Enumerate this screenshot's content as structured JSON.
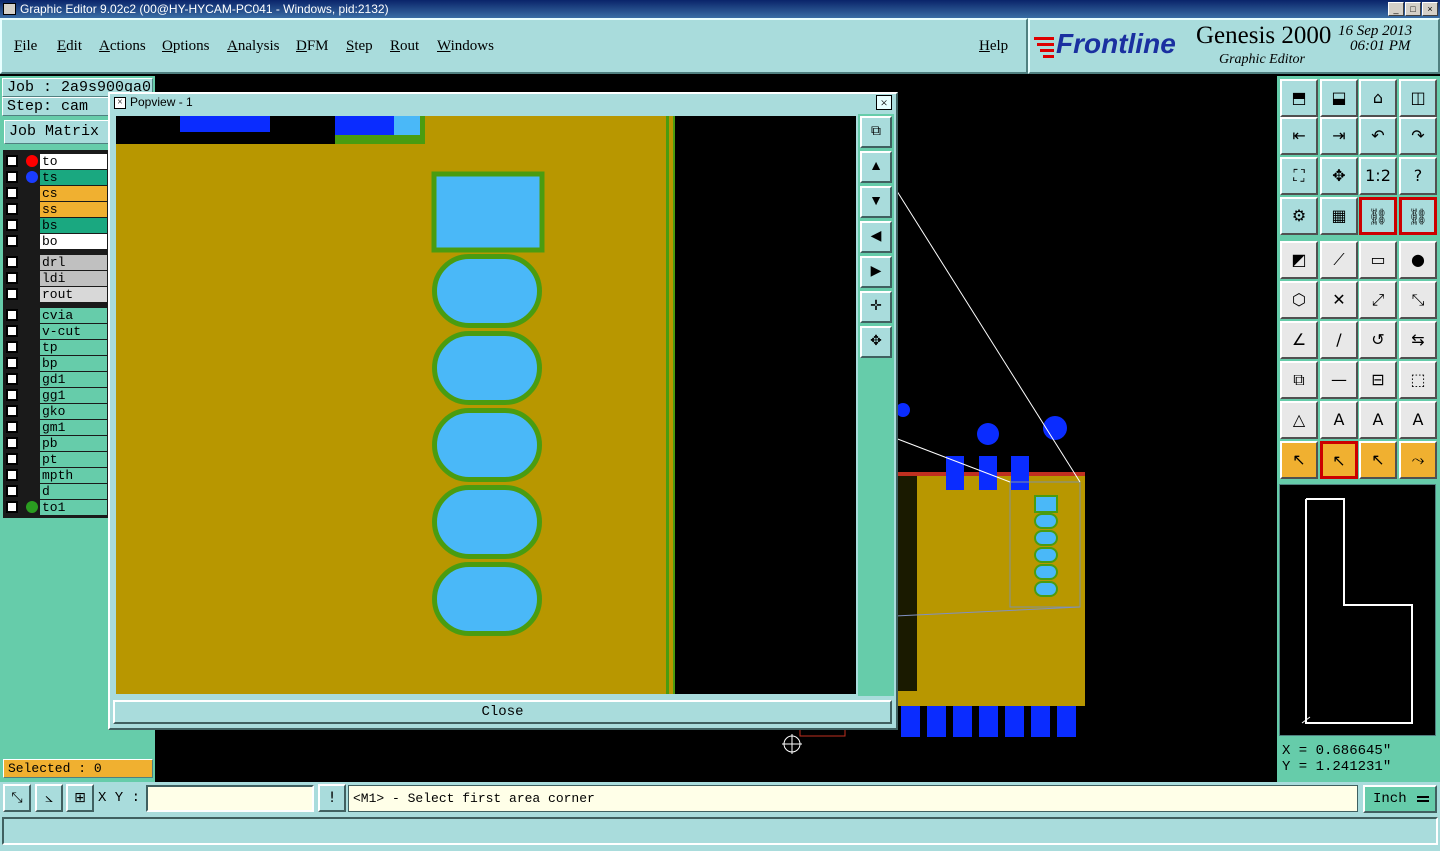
{
  "window": {
    "title": "Graphic Editor 9.02c2 (00@HY-HYCAM-PC041 - Windows, pid:2132)"
  },
  "menu": {
    "items": [
      "File",
      "Edit",
      "Actions",
      "Options",
      "Analysis",
      "DFM",
      "Step",
      "Rout",
      "Windows"
    ],
    "help": "Help"
  },
  "brand": {
    "logo": "Frontline",
    "product": "Genesis 2000",
    "subtitle": "Graphic Editor",
    "date": "16 Sep 2013",
    "time": "06:01 PM"
  },
  "job": {
    "job_label": "Job : 2a9s900ga0",
    "step_label": "Step: cam",
    "matrix_button": "Job Matrix"
  },
  "layers": [
    {
      "name": "to",
      "bg": "#ffffff",
      "dot": "#ff0000"
    },
    {
      "name": "ts",
      "bg": "#1aa880",
      "dot": "#1a3cff"
    },
    {
      "name": "cs",
      "bg": "#f0b030",
      "dot": ""
    },
    {
      "name": "ss",
      "bg": "#f0b030",
      "dot": ""
    },
    {
      "name": "bs",
      "bg": "#1aa880",
      "dot": ""
    },
    {
      "name": "bo",
      "bg": "#ffffff",
      "dot": ""
    },
    {
      "name": "drl",
      "bg": "#c0c0c0",
      "dot": ""
    },
    {
      "name": "ldi",
      "bg": "#c0c0c0",
      "dot": ""
    },
    {
      "name": "rout",
      "bg": "#d8d8d8",
      "dot": ""
    },
    {
      "name": "cvia",
      "bg": "#66ccaa",
      "dot": ""
    },
    {
      "name": "v-cut",
      "bg": "#66ccaa",
      "dot": ""
    },
    {
      "name": "tp",
      "bg": "#66ccaa",
      "dot": ""
    },
    {
      "name": "bp",
      "bg": "#66ccaa",
      "dot": ""
    },
    {
      "name": "gd1",
      "bg": "#66ccaa",
      "dot": ""
    },
    {
      "name": "gg1",
      "bg": "#66ccaa",
      "dot": ""
    },
    {
      "name": "gko",
      "bg": "#66ccaa",
      "dot": ""
    },
    {
      "name": "gm1",
      "bg": "#66ccaa",
      "dot": ""
    },
    {
      "name": "pb",
      "bg": "#66ccaa",
      "dot": ""
    },
    {
      "name": "pt",
      "bg": "#66ccaa",
      "dot": ""
    },
    {
      "name": "mpth",
      "bg": "#66ccaa",
      "dot": ""
    },
    {
      "name": "d",
      "bg": "#66ccaa",
      "dot": ""
    },
    {
      "name": "to1",
      "bg": "#66ccaa",
      "dot": "#2a9c20"
    }
  ],
  "selected": "Selected : 0",
  "popview": {
    "title": "Popview - 1",
    "close_label": "Close"
  },
  "coords": {
    "x": "X = 0.686645\"",
    "y": "Y = 1.241231\""
  },
  "status": {
    "xy_label": "X Y :",
    "xy_value": "",
    "prompt": "<M1> - Select first area corner",
    "units": "Inch",
    "bang": "!"
  },
  "colors": {
    "panel": "#a9dcdc",
    "board": "#b89700",
    "pad": "#4ab8f8",
    "solder": "#4a9c10",
    "blue": "#0a2cff"
  }
}
